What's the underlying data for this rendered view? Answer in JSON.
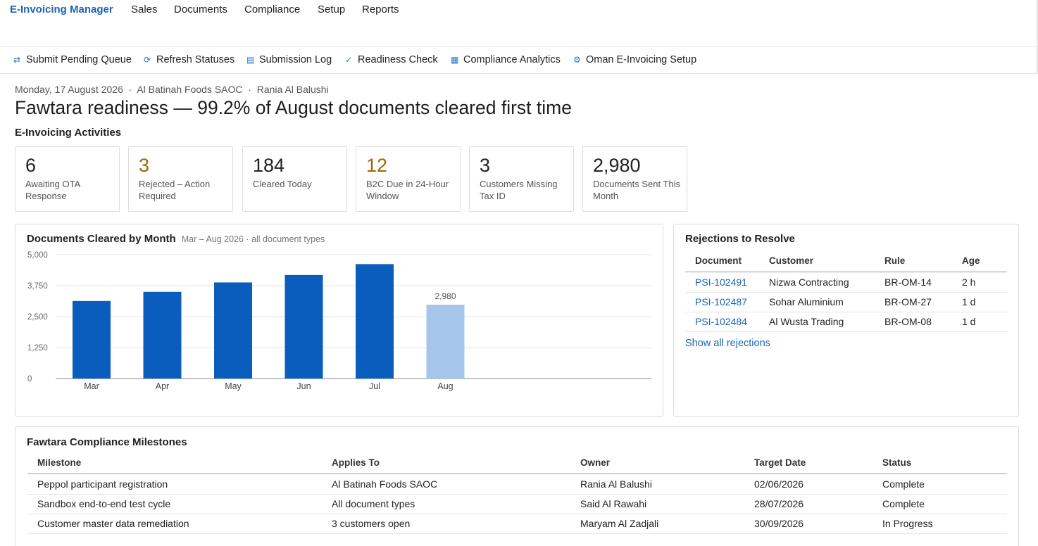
{
  "nav": {
    "brand": "E-Invoicing Manager",
    "items": [
      "Sales",
      "Documents",
      "Compliance",
      "Setup",
      "Reports"
    ]
  },
  "actions": [
    {
      "icon": "arrows-swap-icon",
      "glyph": "⇄",
      "label": "Submit Pending Queue"
    },
    {
      "icon": "refresh-icon",
      "glyph": "⟳",
      "label": "Refresh Statuses"
    },
    {
      "icon": "log-icon",
      "glyph": "▤",
      "label": "Submission Log"
    },
    {
      "icon": "checkmark-icon",
      "glyph": "✓",
      "label": "Readiness Check"
    },
    {
      "icon": "grid-icon",
      "glyph": "▦",
      "label": "Compliance Analytics"
    },
    {
      "icon": "gear-icon",
      "glyph": "⚙",
      "label": "Oman E-Invoicing Setup"
    }
  ],
  "header": {
    "meta": "Monday, 17 August 2026  ·  Al Batinah Foods SAOC  ·  Rania Al Balushi",
    "headline": "Fawtara readiness — 99.2% of August documents cleared first time",
    "section": "E-Invoicing Activities"
  },
  "kpis": [
    {
      "value": "6",
      "label": "Awaiting OTA Response",
      "warn": false
    },
    {
      "value": "3",
      "label": "Rejected – Action Required",
      "warn": true
    },
    {
      "value": "184",
      "label": "Cleared Today",
      "warn": false
    },
    {
      "value": "12",
      "label": "B2C Due in 24-Hour Window",
      "warn": true
    },
    {
      "value": "3",
      "label": "Customers Missing Tax ID",
      "warn": false
    },
    {
      "value": "2,980",
      "label": "Documents Sent This Month",
      "warn": false
    }
  ],
  "colors": {
    "bar": "#0a5dbd",
    "bar_current": "#a5c6ea",
    "accent": "#1a64b8",
    "warn": "#9a6a00"
  },
  "chart_panel": {
    "title": "Documents Cleared by Month",
    "subtitle": "Mar – Aug 2026 · all document types"
  },
  "chart_data": {
    "type": "bar",
    "title": "Documents Cleared by Month",
    "subtitle": "Mar – Aug 2026 · all document types",
    "categories": [
      "Mar",
      "Apr",
      "May",
      "Jun",
      "Jul",
      "Aug"
    ],
    "values": [
      3130,
      3500,
      3880,
      4180,
      4620,
      2980
    ],
    "highlight_index": 5,
    "data_labels": {
      "5": "2,980"
    },
    "ylim": [
      0,
      5000
    ],
    "yticks": [
      0,
      1250,
      2500,
      3750,
      5000
    ],
    "ytick_labels": [
      "0",
      "1,250",
      "2,500",
      "3,750",
      "5,000"
    ],
    "grid": true,
    "legend": "none"
  },
  "rejections": {
    "title": "Rejections to Resolve",
    "columns": [
      "Document",
      "Customer",
      "Rule",
      "Age"
    ],
    "rows": [
      [
        "PSI-102491",
        "Nizwa Contracting",
        "BR-OM-14",
        "2 h"
      ],
      [
        "PSI-102487",
        "Sohar Aluminium",
        "BR-OM-27",
        "1 d"
      ],
      [
        "PSI-102484",
        "Al Wusta Trading",
        "BR-OM-08",
        "1 d"
      ]
    ],
    "show_all": "Show all rejections"
  },
  "milestones": {
    "title": "Fawtara Compliance Milestones",
    "columns": [
      "Milestone",
      "Applies To",
      "Owner",
      "Target Date",
      "Status"
    ],
    "rows": [
      [
        "Peppol participant registration",
        "Al Batinah Foods SAOC",
        "Rania Al Balushi",
        "02/06/2026",
        "Complete"
      ],
      [
        "Sandbox end-to-end test cycle",
        "All document types",
        "Said Al Rawahi",
        "28/07/2026",
        "Complete"
      ],
      [
        "Customer master data remediation",
        "3 customers open",
        "Maryam Al Zadjali",
        "30/09/2026",
        "In Progress"
      ]
    ]
  }
}
